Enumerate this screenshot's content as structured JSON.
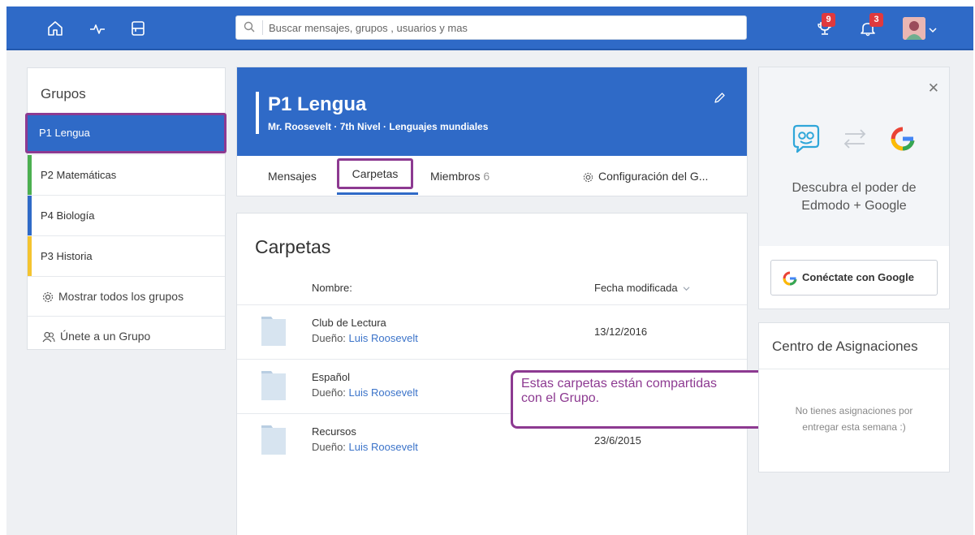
{
  "header": {
    "search_placeholder": "Buscar mensajes, grupos , usuarios y mas",
    "trophy_badge": "9",
    "bell_badge": "3"
  },
  "sidebar": {
    "title": "Grupos",
    "groups": [
      {
        "label": "P1 Lengua",
        "color": "#2f6ac7"
      },
      {
        "label": "P2 Matemáticas",
        "color": "#4caf50"
      },
      {
        "label": "P4 Biología",
        "color": "#2f6ac7"
      },
      {
        "label": "P3 Historia",
        "color": "#f4c430"
      }
    ],
    "show_all": "Mostrar todos los grupos",
    "join": "Únete a un Grupo"
  },
  "group": {
    "title": "P1 Lengua",
    "subtitle": "Mr. Roosevelt · 7th Nivel · Lenguajes mundiales",
    "tabs": {
      "messages": "Mensajes",
      "folders": "Carpetas",
      "members": "Miembros",
      "members_count": "6",
      "settings": "Configuración del G..."
    }
  },
  "folders": {
    "title": "Carpetas",
    "col_name": "Nombre:",
    "col_date": "Fecha modificada",
    "owner_label": "Dueño:",
    "rows": [
      {
        "name": "Club de Lectura",
        "owner": "Luis Roosevelt",
        "date": "13/12/2016"
      },
      {
        "name": "Español",
        "owner": "Luis Roosevelt",
        "date": ""
      },
      {
        "name": "Recursos",
        "owner": "Luis Roosevelt",
        "date": "23/6/2015"
      }
    ]
  },
  "callout": {
    "line1": "Estas carpetas están compartidas",
    "line2": "con el Grupo."
  },
  "google_card": {
    "line1": "Descubra el poder de",
    "line2": "Edmodo + Google",
    "button": "Conéctate con Google"
  },
  "assignments": {
    "title": "Centro de Asignaciones",
    "line1": "No tienes asignaciones por",
    "line2": "entregar esta semana :)"
  },
  "colors": {
    "brand_blue": "#2f6ac7",
    "highlight_purple": "#8d3a91",
    "link_blue": "#3b73c9",
    "badge_red": "#e0393e"
  }
}
